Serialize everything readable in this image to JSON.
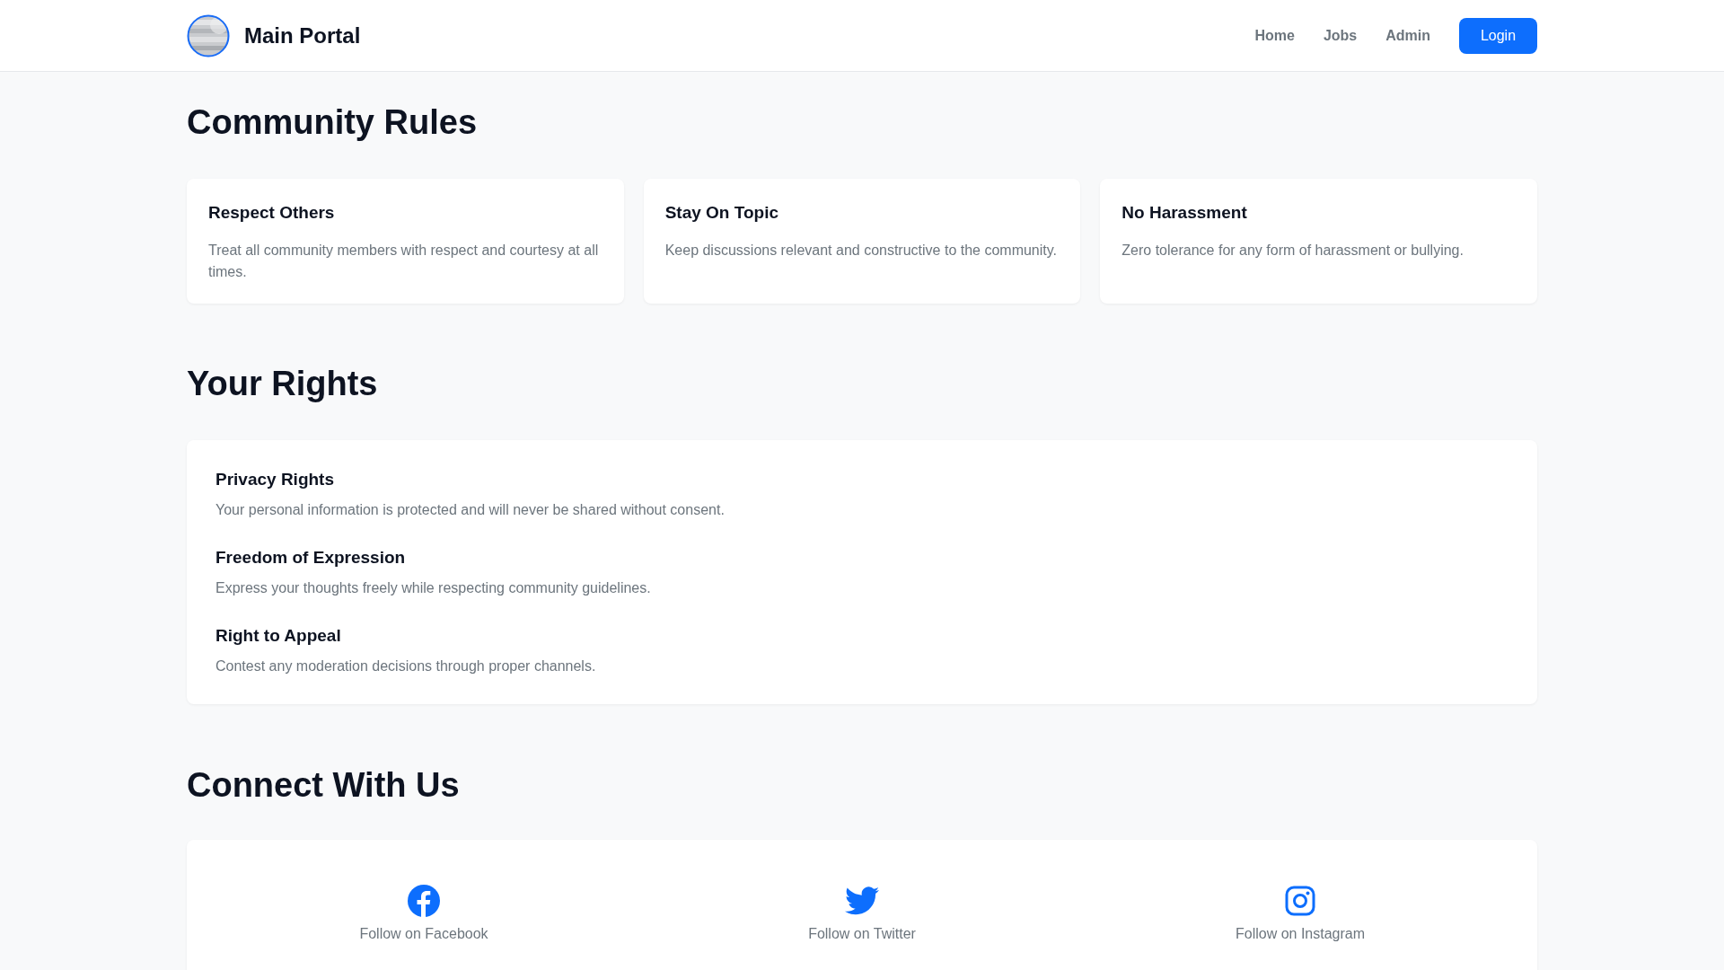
{
  "header": {
    "brand": "Main Portal",
    "nav": [
      {
        "label": "Home"
      },
      {
        "label": "Jobs"
      },
      {
        "label": "Admin"
      }
    ],
    "login": "Login"
  },
  "community_rules": {
    "title": "Community Rules",
    "cards": [
      {
        "title": "Respect Others",
        "text": "Treat all community members with respect and courtesy at all times."
      },
      {
        "title": "Stay On Topic",
        "text": "Keep discussions relevant and constructive to the community."
      },
      {
        "title": "No Harassment",
        "text": "Zero tolerance for any form of harassment or bullying."
      }
    ]
  },
  "your_rights": {
    "title": "Your Rights",
    "items": [
      {
        "title": "Privacy Rights",
        "text": "Your personal information is protected and will never be shared without consent."
      },
      {
        "title": "Freedom of Expression",
        "text": "Express your thoughts freely while respecting community guidelines."
      },
      {
        "title": "Right to Appeal",
        "text": "Contest any moderation decisions through proper channels."
      }
    ]
  },
  "connect": {
    "title": "Connect With Us",
    "links": [
      {
        "kind": "facebook",
        "label": "Follow on Facebook"
      },
      {
        "kind": "twitter",
        "label": "Follow on Twitter"
      },
      {
        "kind": "instagram",
        "label": "Follow on Instagram"
      }
    ]
  }
}
